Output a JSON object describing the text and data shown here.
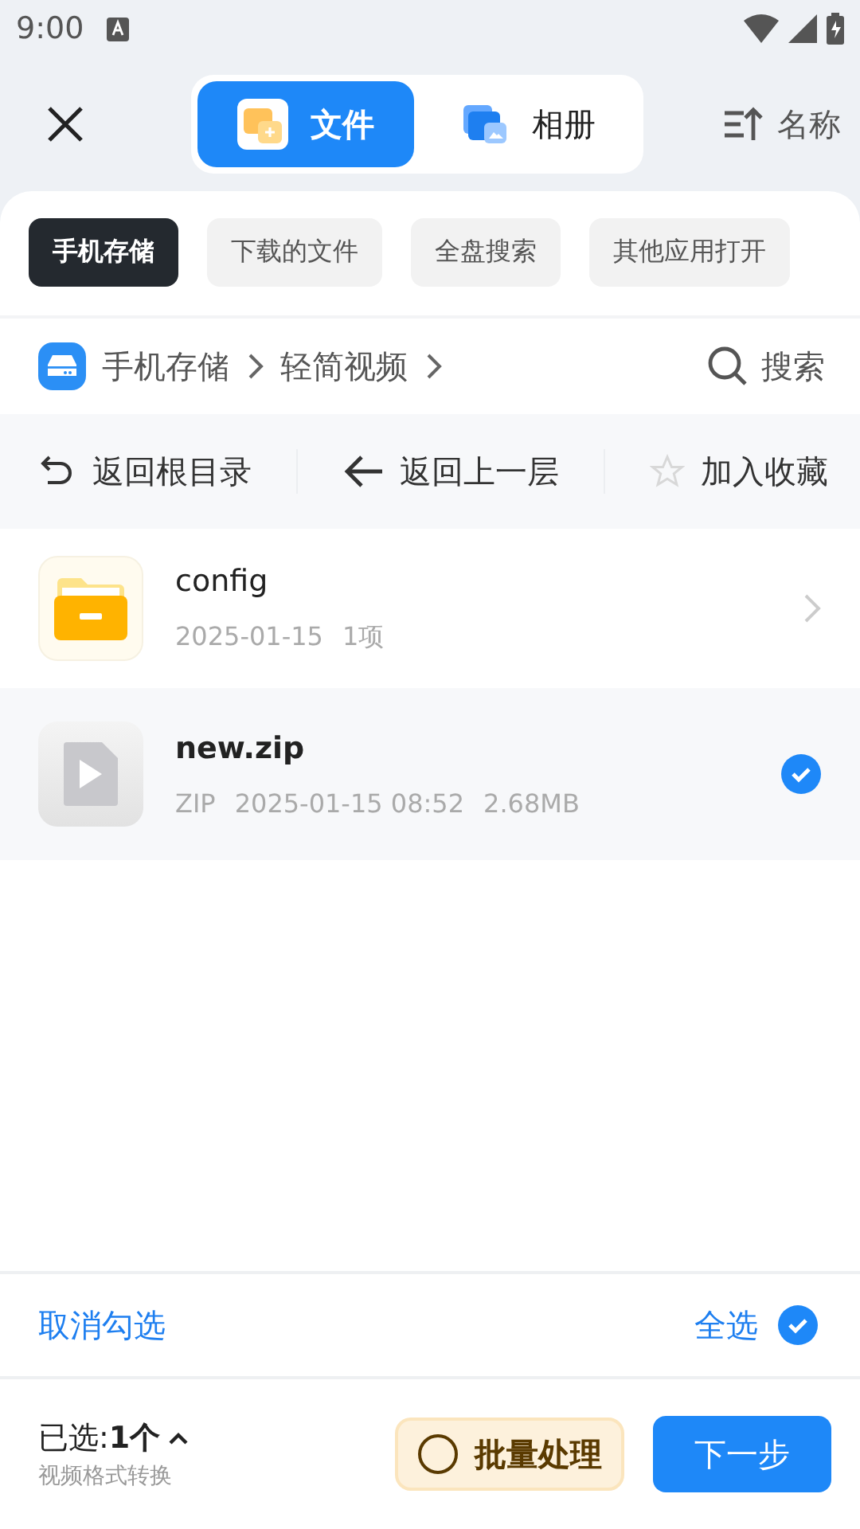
{
  "status_bar": {
    "time": "9:00"
  },
  "header": {
    "tabs": [
      {
        "label": "文件",
        "selected": true,
        "kind": "files"
      },
      {
        "label": "相册",
        "selected": false,
        "kind": "album"
      }
    ],
    "sort": "名称"
  },
  "chips": [
    {
      "label": "手机存储",
      "selected": true
    },
    {
      "label": "下载的文件",
      "selected": false
    },
    {
      "label": "全盘搜索",
      "selected": false
    },
    {
      "label": "其他应用打开",
      "selected": false
    }
  ],
  "breadcrumb": {
    "items": [
      "手机存储",
      "轻简视频"
    ],
    "search": "搜索"
  },
  "actions": [
    {
      "label": "返回根目录",
      "kind": "root"
    },
    {
      "label": "返回上一层",
      "kind": "up"
    },
    {
      "label": "加入收藏",
      "kind": "star"
    }
  ],
  "files": [
    {
      "kind": "folder",
      "name": "config",
      "meta": [
        "2025-01-15",
        "1项"
      ],
      "selected": false
    },
    {
      "kind": "video",
      "name": "new.zip",
      "meta": [
        "ZIP",
        "2025-01-15 08:52",
        "2.68MB"
      ],
      "selected": true
    }
  ],
  "selection_bar": {
    "clear": "取消勾选",
    "select_all": "全选",
    "all_checked": true
  },
  "footer": {
    "count_label": "已选:",
    "count": "1个",
    "subtitle": "视频格式转换",
    "batch": {
      "label": "批量处理",
      "checked": false
    },
    "next": "下一步"
  }
}
